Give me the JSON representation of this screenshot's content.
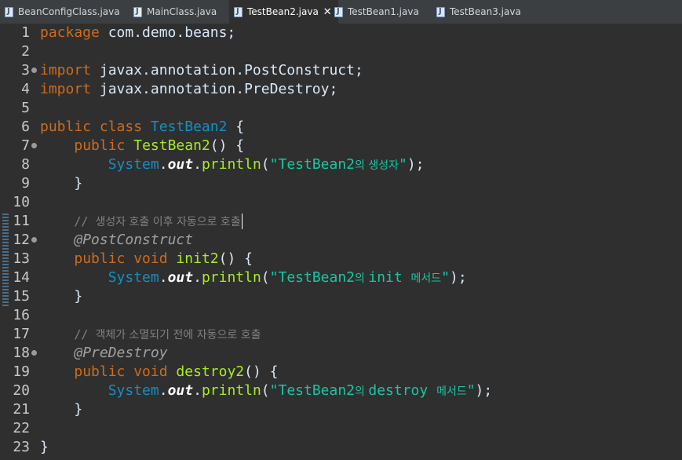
{
  "tabs": [
    {
      "label": "BeanConfigClass.java",
      "active": false
    },
    {
      "label": "MainClass.java",
      "active": false
    },
    {
      "label": "TestBean2.java",
      "active": true
    },
    {
      "label": "TestBean1.java",
      "active": false
    },
    {
      "label": "TestBean3.java",
      "active": false
    }
  ],
  "close_glyph": "✕",
  "line_numbers": [
    "1",
    "2",
    "3",
    "4",
    "5",
    "6",
    "7",
    "8",
    "9",
    "10",
    "11",
    "12",
    "13",
    "14",
    "15",
    "16",
    "17",
    "18",
    "19",
    "20",
    "21",
    "22",
    "23"
  ],
  "code": {
    "l1_kw": "package",
    "l1_rest": " com.demo.beans;",
    "l3_kw": "import",
    "l3_rest": " javax.annotation.PostConstruct;",
    "l4_kw": "import",
    "l4_rest": " javax.annotation.PreDestroy;",
    "l6_kw": "public class",
    "l6_cls": "TestBean2",
    "l6_rest": " {",
    "l7_kw": "public",
    "l7_m": "TestBean2",
    "l7_rest": "() {",
    "sys": "System",
    "dot": ".",
    "out": "out",
    "println": "println",
    "l8_str_a": "\"TestBean2",
    "l8_str_ko": "의 생성자",
    "l8_str_b": "\"",
    "paren_end": ");",
    "brace_close": "}",
    "l11_comment": "// ",
    "l11_comment_ko": "생성자 호출 이후 자동으로 호출",
    "l12_ann": "@PostConstruct",
    "l13_kw": "public void",
    "l13_m": "init2",
    "l13_rest": "() {",
    "l14_str_a": "\"TestBean2",
    "l14_str_ko1": "의 ",
    "l14_str_b": "init ",
    "l14_str_ko2": "메서드",
    "l14_str_c": "\"",
    "l17_comment": "// ",
    "l17_comment_ko": "객체가 소멸되기 전에 자동으로 호출",
    "l18_ann": "@PreDestroy",
    "l19_kw": "public void",
    "l19_m": "destroy2",
    "l19_rest": "() {",
    "l20_str_a": "\"TestBean2",
    "l20_str_ko1": "의 ",
    "l20_str_b": "destroy ",
    "l20_str_ko2": "메서드",
    "l20_str_c": "\""
  },
  "colors": {
    "background": "#2f2f2f",
    "keyword": "#cc6c1d",
    "class": "#1290c3",
    "method": "#a7ec21",
    "string": "#17c6a3",
    "comment": "#808080",
    "annotation": "#a0a0a0"
  }
}
